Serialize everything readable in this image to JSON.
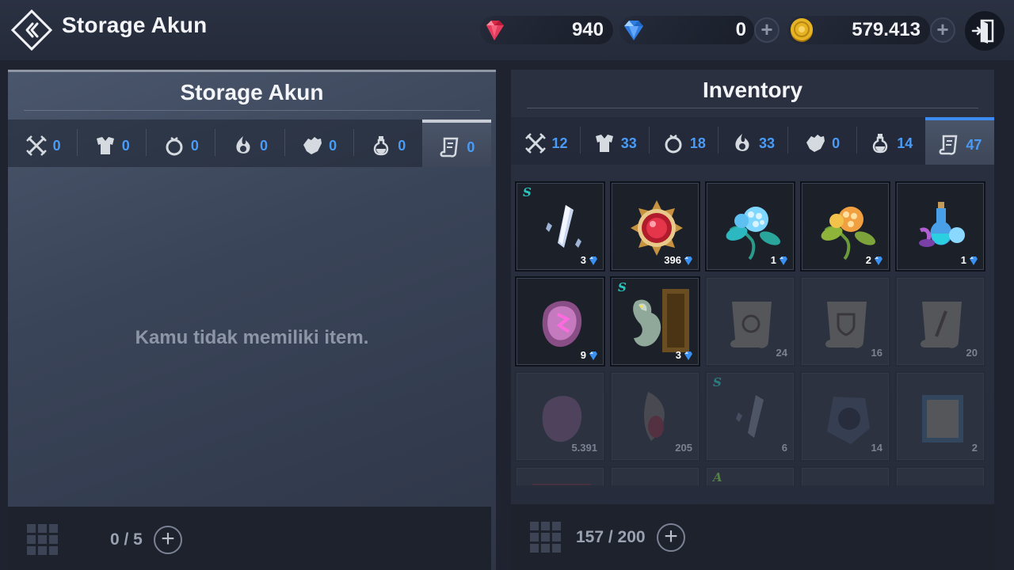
{
  "header": {
    "title": "Storage Akun",
    "currencies": [
      {
        "name": "red-gem",
        "value": "940",
        "color": "#e0324f"
      },
      {
        "name": "blue-diamond",
        "value": "0",
        "color": "#3a8ff0"
      },
      {
        "name": "gold-coin",
        "value": "579.413",
        "color": "#d9a520"
      }
    ]
  },
  "storage": {
    "title": "Storage Akun",
    "tabs": [
      {
        "icon": "weapon-icon",
        "count": "0"
      },
      {
        "icon": "armor-icon",
        "count": "0"
      },
      {
        "icon": "ring-icon",
        "count": "0"
      },
      {
        "icon": "skill-icon",
        "count": "0"
      },
      {
        "icon": "glove-icon",
        "count": "0"
      },
      {
        "icon": "potion-icon",
        "count": "0"
      },
      {
        "icon": "scroll-icon",
        "count": "0",
        "active": true
      }
    ],
    "empty_message": "Kamu tidak memiliki item.",
    "capacity": "0 / 5"
  },
  "inventory": {
    "title": "Inventory",
    "tabs": [
      {
        "icon": "weapon-icon",
        "count": "12"
      },
      {
        "icon": "armor-icon",
        "count": "33"
      },
      {
        "icon": "ring-icon",
        "count": "18"
      },
      {
        "icon": "skill-icon",
        "count": "33"
      },
      {
        "icon": "glove-icon",
        "count": "0"
      },
      {
        "icon": "potion-icon",
        "count": "14"
      },
      {
        "icon": "scroll-icon",
        "count": "47",
        "active": true
      }
    ],
    "items": [
      {
        "name": "crystal-shard",
        "qty": "3",
        "grade": "S",
        "locked": true
      },
      {
        "name": "red-orb-medallion",
        "qty": "396",
        "locked": true
      },
      {
        "name": "blue-berry-plant",
        "qty": "1",
        "locked": true
      },
      {
        "name": "gold-berry-plant",
        "qty": "2",
        "locked": true
      },
      {
        "name": "potion-bundle",
        "qty": "1",
        "locked": true
      },
      {
        "name": "pink-rune-stone",
        "qty": "9",
        "locked": true
      },
      {
        "name": "dragon-card",
        "qty": "3",
        "grade": "S",
        "locked": true
      },
      {
        "name": "ring-scroll",
        "qty": "24",
        "dim": true
      },
      {
        "name": "shield-scroll",
        "qty": "16",
        "dim": true
      },
      {
        "name": "sword-scroll",
        "qty": "20",
        "dim": true
      },
      {
        "name": "pink-rune-stone",
        "qty": "5.391",
        "dim": true
      },
      {
        "name": "red-dragon-gem",
        "qty": "205",
        "dim": true
      },
      {
        "name": "crystal-shard",
        "qty": "6",
        "grade": "S",
        "dim": true
      },
      {
        "name": "dark-relic",
        "qty": "14",
        "dim": true
      },
      {
        "name": "blue-tome",
        "qty": "2",
        "dim": true
      },
      {
        "name": "partial-item-1",
        "qty": "",
        "dim": true
      },
      {
        "name": "partial-item-2",
        "qty": "",
        "dim": true
      },
      {
        "name": "partial-item-3",
        "qty": "",
        "grade": "A",
        "dim": true
      },
      {
        "name": "partial-item-4",
        "qty": "",
        "dim": true
      },
      {
        "name": "partial-item-5",
        "qty": "",
        "dim": true
      }
    ],
    "capacity": "157 / 200"
  }
}
